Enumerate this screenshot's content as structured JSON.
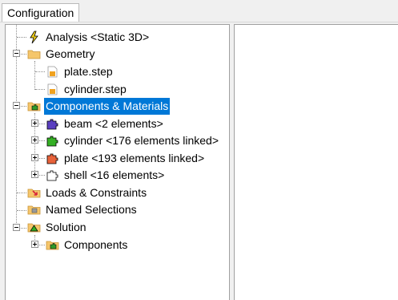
{
  "tabs": [
    {
      "label": "Configuration"
    }
  ],
  "tree": {
    "analysis": {
      "label": "Analysis <Static 3D>",
      "icon": "lightning-icon"
    },
    "geometry": {
      "label": "Geometry",
      "icon": "folder-icon",
      "expanded": true,
      "children": [
        {
          "label": "plate.step",
          "icon": "step-file-icon"
        },
        {
          "label": "cylinder.step",
          "icon": "step-file-icon"
        }
      ]
    },
    "components": {
      "label": "Components & Materials",
      "icon": "puzzle-folder-icon",
      "expanded": true,
      "selected": true,
      "children": [
        {
          "label": "beam <2 elements>",
          "icon": "puzzle-icon",
          "color": "#5a3fc0"
        },
        {
          "label": "cylinder <176 elements linked>",
          "icon": "puzzle-icon",
          "color": "#34b024"
        },
        {
          "label": "plate <193 elements linked>",
          "icon": "puzzle-icon",
          "color": "#e8623a"
        },
        {
          "label": "shell <16 elements>",
          "icon": "puzzle-icon",
          "color": "#ffffff"
        }
      ]
    },
    "loads": {
      "label": "Loads & Constraints",
      "icon": "loads-folder-icon"
    },
    "named_selections": {
      "label": "Named Selections",
      "icon": "named-selections-icon"
    },
    "solution": {
      "label": "Solution",
      "icon": "solution-icon",
      "expanded": true,
      "children": [
        {
          "label": "Components",
          "icon": "puzzle-folder-icon"
        }
      ]
    }
  },
  "colors": {
    "selection": "#0078d7",
    "folder": "#f5c66b"
  }
}
